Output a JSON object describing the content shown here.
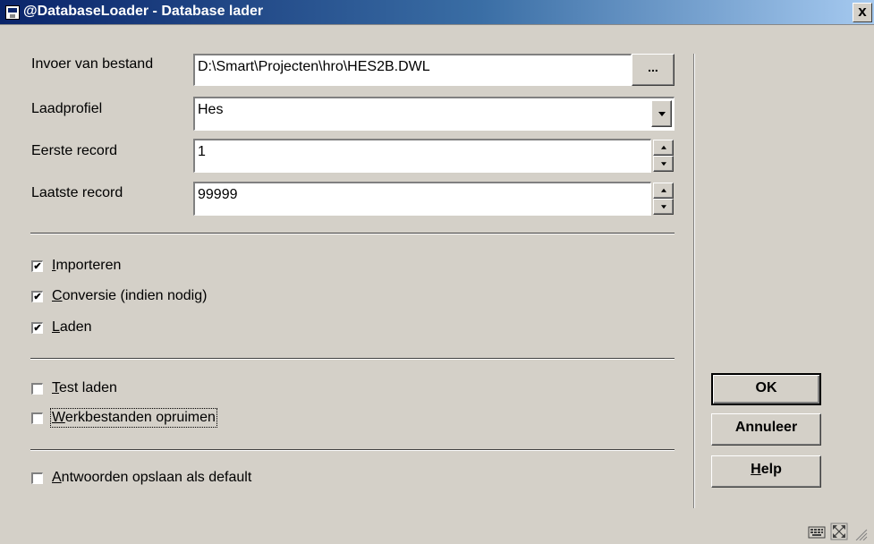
{
  "window": {
    "title": "@DatabaseLoader - Database lader",
    "close_glyph": "x"
  },
  "form": {
    "input_file": {
      "label": "Invoer van bestand",
      "value": "D:\\Smart\\Projecten\\hro\\HES2B.DWL",
      "browse_label": "..."
    },
    "load_profile": {
      "label": "Laadprofiel",
      "value": "Hes"
    },
    "first_record": {
      "label": "Eerste record",
      "value": "1"
    },
    "last_record": {
      "label": "Laatste record",
      "value": "99999"
    }
  },
  "options": [
    {
      "label": "Importeren",
      "checked": true
    },
    {
      "label": "Conversie (indien nodig)",
      "checked": true
    },
    {
      "label": "Laden",
      "checked": true
    },
    {
      "label": "Test laden",
      "checked": false
    },
    {
      "label": "Werkbestanden opruimen",
      "checked": false
    },
    {
      "label": "Antwoorden opslaan als default",
      "checked": false
    }
  ],
  "buttons": {
    "ok": "OK",
    "cancel": "Annuleer",
    "help": "Help"
  },
  "icons": {
    "app": "window-app-icon",
    "close": "close-icon",
    "statusbar": [
      "keyboard-icon",
      "resize-icon"
    ]
  },
  "colors": {
    "title_bar_start": "#0a246a",
    "title_bar_end": "#a6caf0",
    "dialog_background": "#d4d0c8"
  }
}
